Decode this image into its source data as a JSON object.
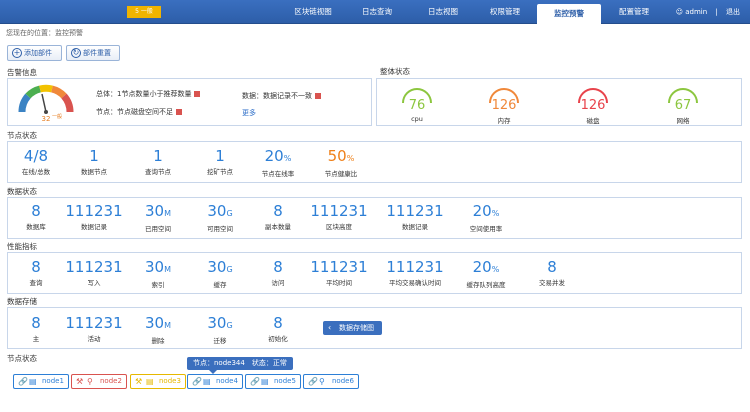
{
  "nav": {
    "logo": "5 一般",
    "items": [
      {
        "label": "区块链视图",
        "active": false
      },
      {
        "label": "日志查询",
        "active": false
      },
      {
        "label": "日志视图",
        "active": false
      },
      {
        "label": "权限管理",
        "active": false
      },
      {
        "label": "监控预警",
        "active": true
      },
      {
        "label": "配置管理",
        "active": false
      }
    ],
    "user": "admin",
    "logout": "退出"
  },
  "breadcrumb": "您现在的位置：监控预警",
  "toolbar": {
    "add_label": "添加部件",
    "reset_label": "部件重置"
  },
  "alerts": {
    "title": "告警信息",
    "gauge_value": "32",
    "gauge_level": "一般",
    "items": [
      "总体：1节点数量小于推荐数量",
      "数据：数据记录不一致",
      "节点：节点磁盘空间不足"
    ],
    "more": "更多"
  },
  "overall": {
    "title": "整体状态",
    "rings": [
      {
        "value": "76",
        "label": "cpu",
        "color": "#8cc63f"
      },
      {
        "value": "126",
        "label": "内存",
        "color": "#f0883a"
      },
      {
        "value": "126",
        "label": "磁盘",
        "color": "#e8434b"
      },
      {
        "value": "67",
        "label": "网络",
        "color": "#8cc63f"
      }
    ]
  },
  "sections": [
    {
      "title": "节点状态",
      "stats": [
        {
          "value": "4/8",
          "unit": "",
          "label": "在线/总数",
          "color": "blue"
        },
        {
          "value": "1",
          "unit": "",
          "label": "数据节点",
          "color": "blue"
        },
        {
          "value": "1",
          "unit": "",
          "label": "查询节点",
          "color": "blue"
        },
        {
          "value": "1",
          "unit": "",
          "label": "挖矿节点",
          "color": "blue"
        },
        {
          "value": "20",
          "unit": "%",
          "label": "节点在线率",
          "color": "blue"
        },
        {
          "value": "50",
          "unit": "%",
          "label": "节点健康比",
          "color": "orange"
        }
      ]
    },
    {
      "title": "数据状态",
      "stats": [
        {
          "value": "8",
          "unit": "",
          "label": "数据库",
          "color": "blue"
        },
        {
          "value": "111231",
          "unit": "",
          "label": "数据记录",
          "color": "blue"
        },
        {
          "value": "30",
          "unit": "M",
          "label": "已用空间",
          "color": "blue"
        },
        {
          "value": "30",
          "unit": "G",
          "label": "可用空间",
          "color": "blue"
        },
        {
          "value": "8",
          "unit": "",
          "label": "副本数量",
          "color": "blue"
        },
        {
          "value": "111231",
          "unit": "",
          "label": "区块高度",
          "color": "blue"
        },
        {
          "value": "111231",
          "unit": "",
          "label": "数据记录",
          "color": "blue"
        },
        {
          "value": "20",
          "unit": "%",
          "label": "空间使用率",
          "color": "blue"
        }
      ]
    },
    {
      "title": "性能指标",
      "stats": [
        {
          "value": "8",
          "unit": "",
          "label": "查询",
          "color": "blue"
        },
        {
          "value": "111231",
          "unit": "",
          "label": "写入",
          "color": "blue"
        },
        {
          "value": "30",
          "unit": "M",
          "label": "索引",
          "color": "blue"
        },
        {
          "value": "30",
          "unit": "G",
          "label": "缓存",
          "color": "blue"
        },
        {
          "value": "8",
          "unit": "",
          "label": "访问",
          "color": "blue"
        },
        {
          "value": "111231",
          "unit": "",
          "label": "平均时间",
          "color": "blue"
        },
        {
          "value": "111231",
          "unit": "",
          "label": "平均交易确认时间",
          "color": "blue"
        },
        {
          "value": "20",
          "unit": "%",
          "label": "缓存队列高度",
          "color": "blue"
        },
        {
          "value": "8",
          "unit": "",
          "label": "交易并发",
          "color": "blue"
        }
      ]
    },
    {
      "title": "数据存储",
      "stats": [
        {
          "value": "8",
          "unit": "",
          "label": "主",
          "color": "blue"
        },
        {
          "value": "111231",
          "unit": "",
          "label": "活动",
          "color": "blue"
        },
        {
          "value": "30",
          "unit": "M",
          "label": "删除",
          "color": "blue"
        },
        {
          "value": "30",
          "unit": "G",
          "label": "迁移",
          "color": "blue"
        },
        {
          "value": "8",
          "unit": "",
          "label": "初始化",
          "color": "blue"
        }
      ],
      "button": "数据存储图"
    }
  ],
  "nodes": {
    "title": "节点状态",
    "tooltip": "节点：node344　状态：正常",
    "items": [
      {
        "label": "node1",
        "color": "#2d7fd6"
      },
      {
        "label": "node2",
        "color": "#d9534f"
      },
      {
        "label": "node3",
        "color": "#e6b800"
      },
      {
        "label": "node4",
        "color": "#2d7fd6"
      },
      {
        "label": "node5",
        "color": "#2d7fd6"
      },
      {
        "label": "node6",
        "color": "#2d7fd6"
      }
    ]
  }
}
